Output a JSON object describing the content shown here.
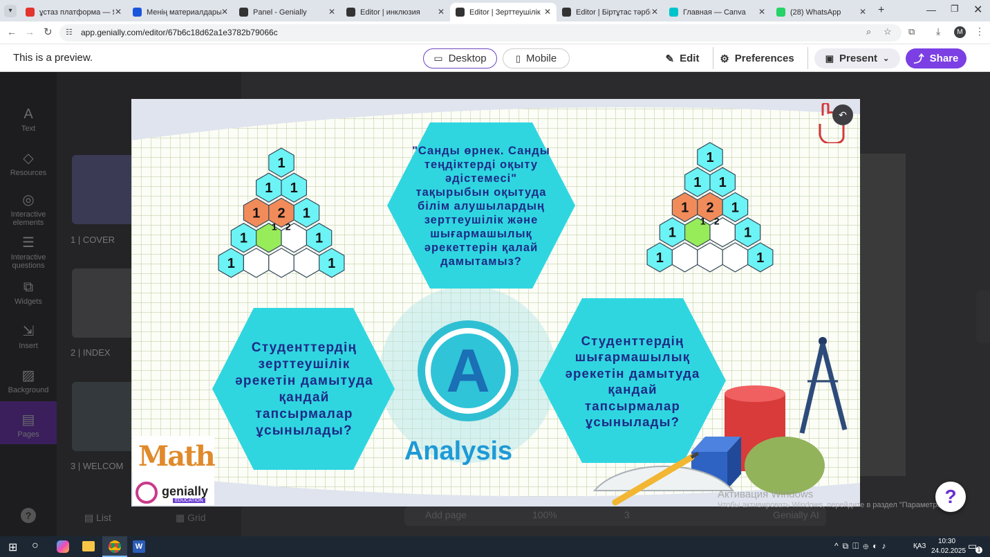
{
  "browser": {
    "tabs": [
      {
        "label": "ұстаз платформа — Янде",
        "favicon_color": "#e3342f"
      },
      {
        "label": "Менің материалдарым | ",
        "favicon_color": "#1a56db"
      },
      {
        "label": "Panel - Genially",
        "favicon_color": "#333333"
      },
      {
        "label": "Editor | инклюзия",
        "favicon_color": "#333333"
      },
      {
        "label": "Editor | Зерттеушілік",
        "favicon_color": "#333333"
      },
      {
        "label": "Editor | Біртұтас тәрбие",
        "favicon_color": "#333333"
      },
      {
        "label": "Главная — Canva",
        "favicon_color": "#00c4cc"
      },
      {
        "label": "(28) WhatsApp",
        "favicon_color": "#25d366"
      }
    ],
    "active_tab_index": 4,
    "url": "app.genially.com/editor/67b6c18d62a1e3782b79066c",
    "profile_initial": "M"
  },
  "preview_header": {
    "notice": "This is a preview.",
    "desktop_label": "Desktop",
    "mobile_label": "Mobile",
    "edit_label": "Edit",
    "preferences_label": "Preferences",
    "present_label": "Present",
    "share_label": "Share"
  },
  "editor": {
    "nav": [
      "Text",
      "Resources",
      "Interactive elements",
      "Interactive questions",
      "Widgets",
      "Insert",
      "Background",
      "Pages"
    ],
    "pages": [
      "1 | COVER",
      "2 | INDEX",
      "3 | WELCOM"
    ],
    "list_label": "List",
    "grid_label": "Grid",
    "add_page_label": "Add page",
    "zoom_label": "100%",
    "page_number": "3",
    "ai_label": "Genially AI"
  },
  "slide": {
    "top_hex_text": "\"Санды өрнек. Санды теңдіктерді оқыту әдістемесі\" тақырыбын оқытуда білім алушылардың зерттеушілік және шығармашылық әрекеттерін қалай дамытамыз?",
    "left_hex_text": "Студенттердің зерттеушілік әрекетін дамытуда қандай тапсырмалар ұсынылады?",
    "right_hex_text": "Студенттердің шығармашылық әрекетін дамытуда қандай тапсырмалар ұсынылады?",
    "center_letter": "A",
    "center_label": "Analysis",
    "logo_math": "Math",
    "logo_brand": "genially",
    "logo_sub": "EDUCATION",
    "pyramid_rows": [
      [
        "1"
      ],
      [
        "1",
        "1"
      ],
      [
        "1",
        "2",
        "1"
      ],
      [
        "1",
        "",
        "",
        "1"
      ],
      [
        "1",
        "",
        "",
        "",
        "1"
      ]
    ],
    "pyramid_small": [
      "1",
      "2"
    ]
  },
  "overlay": {
    "watermark_title": "Активация Windows",
    "watermark_text": "Чтобы активировать Windows, перейдите в раздел \"Параметры\"."
  },
  "taskbar": {
    "language": "ҚАЗ",
    "time": "10:30",
    "date": "24.02.2025",
    "notification_count": "1"
  }
}
